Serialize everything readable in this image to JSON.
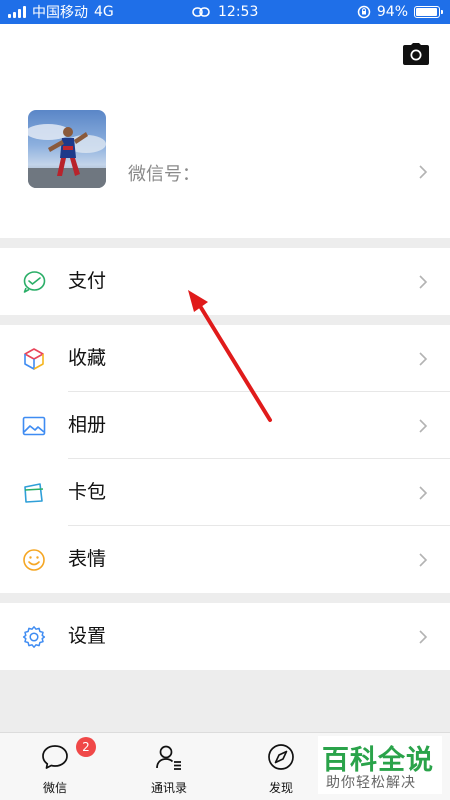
{
  "status_bar": {
    "carrier": "中国移动",
    "network": "4G",
    "time": "12:53",
    "battery": "94%",
    "battery_level": 0.94
  },
  "profile": {
    "wechat_id_label": "微信号："
  },
  "menu": {
    "pay": "支付",
    "favorites": "收藏",
    "album": "相册",
    "cards": "卡包",
    "stickers": "表情",
    "settings": "设置"
  },
  "tabbar": {
    "chats": "微信",
    "chats_badge": "2",
    "contacts": "通讯录",
    "discover": "发现"
  },
  "watermark": {
    "title": "百科全说",
    "subtitle": "助你轻松解决"
  },
  "colors": {
    "status_bar": "#1f6fe8",
    "pay_icon": "#2aae67",
    "annotation_arrow": "#e01b1b",
    "badge": "#f04848"
  }
}
